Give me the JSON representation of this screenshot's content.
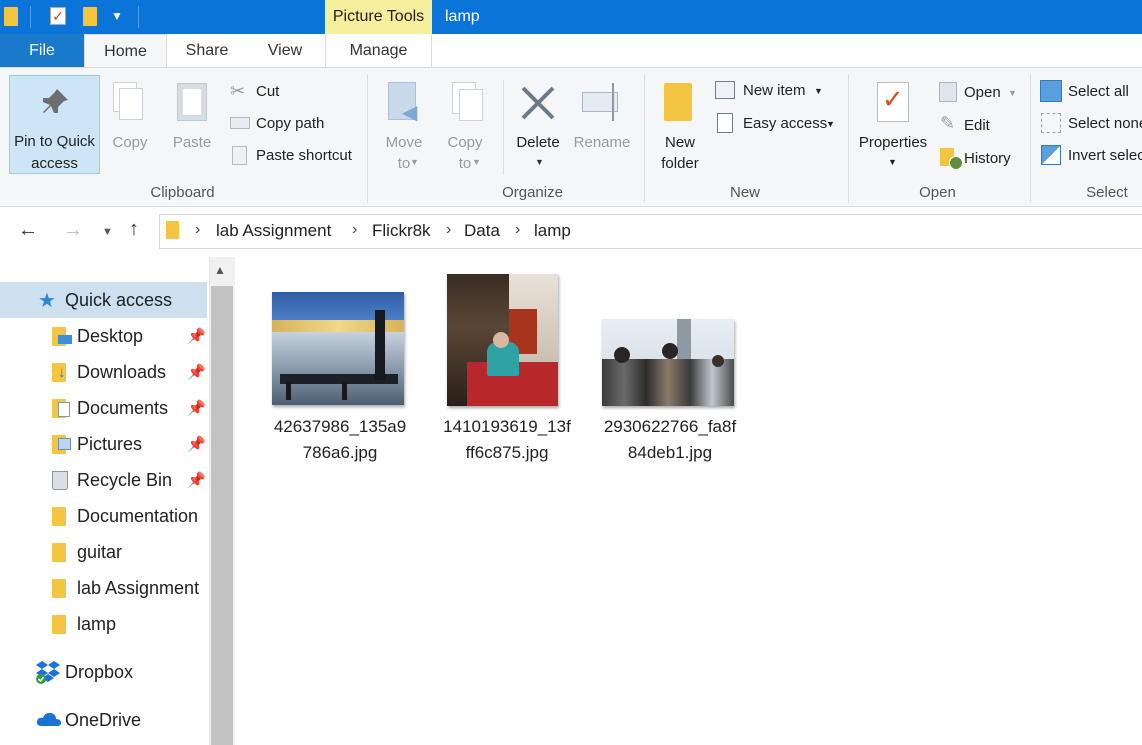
{
  "titlebar": {
    "contextual_tab": "Picture Tools",
    "window_title": "lamp"
  },
  "tabs": {
    "file": "File",
    "home": "Home",
    "share": "Share",
    "view": "View",
    "manage": "Manage"
  },
  "ribbon": {
    "clipboard": {
      "label": "Clipboard",
      "pin_line1": "Pin to Quick",
      "pin_line2": "access",
      "copy": "Copy",
      "paste": "Paste",
      "cut": "Cut",
      "copy_path": "Copy path",
      "paste_shortcut": "Paste shortcut"
    },
    "organize": {
      "label": "Organize",
      "move_to_1": "Move",
      "move_to_2": "to",
      "copy_to_1": "Copy",
      "copy_to_2": "to",
      "delete": "Delete",
      "rename": "Rename"
    },
    "new": {
      "label": "New",
      "new_folder_1": "New",
      "new_folder_2": "folder",
      "new_item": "New item",
      "easy_access": "Easy access"
    },
    "open": {
      "label": "Open",
      "properties": "Properties",
      "open": "Open",
      "edit": "Edit",
      "history": "History"
    },
    "select": {
      "label": "Select",
      "select_all": "Select all",
      "select_none": "Select none",
      "invert_selection": "Invert selection"
    }
  },
  "breadcrumb": [
    "lab Assignment",
    "Flickr8k",
    "Data",
    "lamp"
  ],
  "navpane": {
    "quick_access": "Quick access",
    "items": [
      {
        "label": "Desktop",
        "pinned": true
      },
      {
        "label": "Downloads",
        "pinned": true
      },
      {
        "label": "Documents",
        "pinned": true
      },
      {
        "label": "Pictures",
        "pinned": true
      },
      {
        "label": "Recycle Bin",
        "pinned": true
      },
      {
        "label": "Documentation",
        "pinned": false
      },
      {
        "label": "guitar",
        "pinned": false
      },
      {
        "label": "lab Assignment",
        "pinned": false
      },
      {
        "label": "lamp",
        "pinned": false
      }
    ],
    "dropbox": "Dropbox",
    "onedrive": "OneDrive"
  },
  "files": [
    {
      "name_line1": "42637986_135a9",
      "name_line2": "786a6.jpg"
    },
    {
      "name_line1": "1410193619_13f",
      "name_line2": "ff6c875.jpg"
    },
    {
      "name_line1": "2930622766_fa8f",
      "name_line2": "84deb1.jpg"
    }
  ],
  "colors": {
    "titlebar": "#0a74d8",
    "file_tab": "#1979ca",
    "contextual": "#f5ee9c",
    "selection": "#cce0f0"
  }
}
